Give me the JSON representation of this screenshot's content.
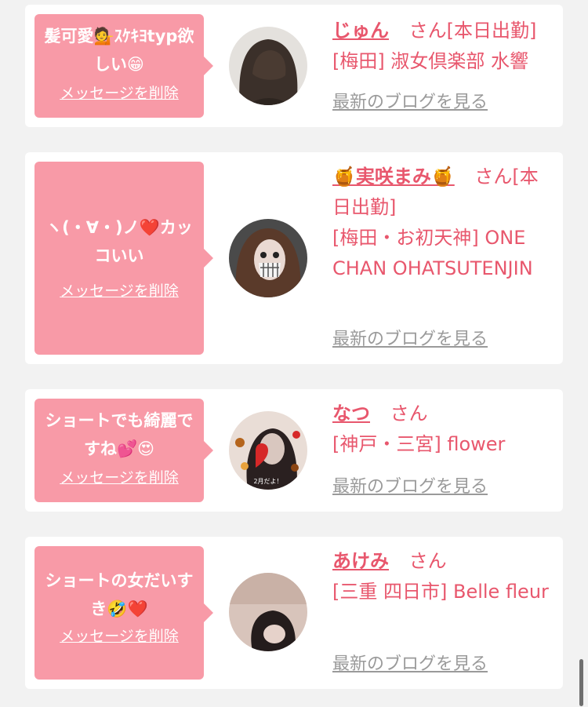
{
  "items": [
    {
      "message": "髪可愛💁ｽｹｷﾖtyp欲しい😁",
      "delete_label": "メッセージを削除",
      "name": "じゅん",
      "suffix": "さん[本日出勤]",
      "shop": "[梅田] 淑女倶楽部 水響",
      "blog_label": "最新のブログを見る"
    },
    {
      "message": "ヽ(・∀・)ノ❤️カッコいい",
      "delete_label": "メッセージを削除",
      "name": "🍯実咲まみ🍯",
      "suffix": "さん[本日出勤]",
      "shop": "[梅田・お初天神] ONE CHAN OHATSUTENJIN",
      "blog_label": "最新のブログを見る"
    },
    {
      "message": "ショートでも綺麗ですね💕😍",
      "delete_label": "メッセージを削除",
      "name": "なつ",
      "suffix": "さん",
      "shop": "[神戸・三宮] flower",
      "blog_label": "最新のブログを見る"
    },
    {
      "message": "ショートの女だいすき🤣❤️",
      "delete_label": "メッセージを削除",
      "name": "あけみ",
      "suffix": "さん",
      "shop": "[三重 四日市] Belle fleur",
      "blog_label": "最新のブログを見る"
    }
  ],
  "avatar3_caption": "2月だよ！",
  "colors": {
    "accent": "#e8576d",
    "bubble": "#f89aa7",
    "link_gray": "#9a9a9a",
    "background": "#f2f2f2"
  }
}
